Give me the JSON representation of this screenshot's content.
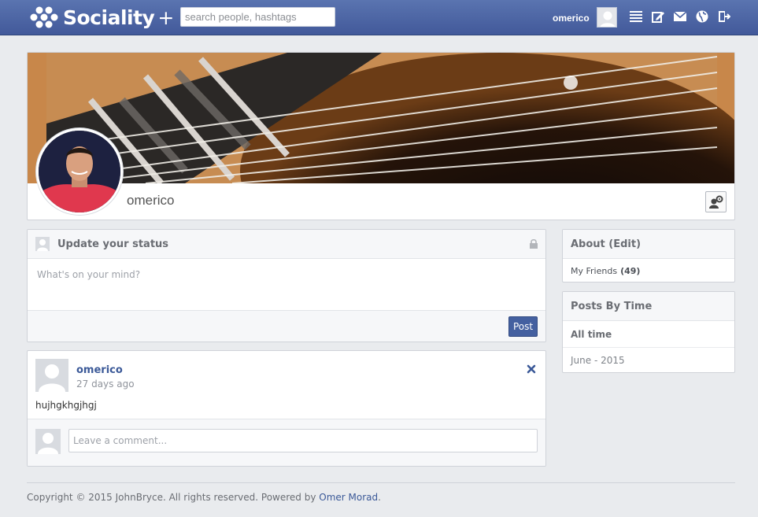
{
  "app": {
    "name": "Sociality",
    "name_suffix": "+"
  },
  "header": {
    "search_placeholder": "search people, hashtags",
    "username": "omerico",
    "icons": [
      "list-icon",
      "edit-icon",
      "mail-icon",
      "globe-icon",
      "logout-icon"
    ]
  },
  "profile": {
    "name": "omerico",
    "settings_icon": "user-settings-icon"
  },
  "status": {
    "title": "Update your status",
    "placeholder": "What's on your mind?",
    "post_label": "Post"
  },
  "feed": {
    "posts": [
      {
        "author": "omerico",
        "time": "27 days ago",
        "body": "hujhgkhgjhgj",
        "comment_placeholder": "Leave a comment..."
      }
    ]
  },
  "sidebar": {
    "about_title": "About (Edit)",
    "friends_label": "My Friends",
    "friends_count": "(49)",
    "posts_by_time_title": "Posts By Time",
    "time_filters": [
      "All time",
      "June - 2015"
    ]
  },
  "footer": {
    "copyright": "Copyright © 2015 JohnBryce. All rights reserved. Powered by",
    "author_link": "Omer Morad",
    "period": "."
  },
  "colors": {
    "topbar": "#4b64a4",
    "accent": "#3b5998",
    "background": "#e9ebee"
  }
}
